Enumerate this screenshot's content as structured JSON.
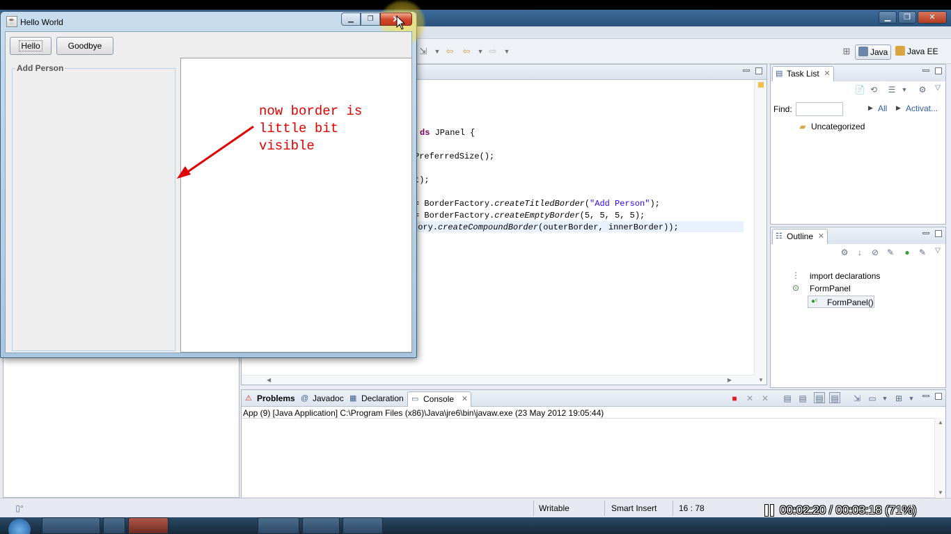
{
  "swing_window": {
    "title": "Hello World",
    "buttons": {
      "hello": "Hello",
      "goodbye": "Goodbye"
    },
    "form_panel_title": "Add Person"
  },
  "annotation": {
    "text": "now border is\nlittle bit\nvisible",
    "color": "#e00000"
  },
  "eclipse": {
    "perspectives": [
      {
        "label": "Java",
        "active": true
      },
      {
        "label": "Java EE",
        "active": false
      }
    ],
    "editor": {
      "code_lines": {
        "class_decl_kw": "ds",
        "class_decl_rest": " JPanel {",
        "size_line": "PreferredSize();",
        "set_size_line": "t);",
        "outer_prefix": "= BorderFactory.",
        "outer_method": "createTitledBorder",
        "outer_arg": "\"Add Person\"",
        "outer_end": ");",
        "inner_prefix": "= BorderFactory.",
        "inner_method": "createEmptyBorder",
        "inner_args": "(5, 5, 5, 5);",
        "compound_prefix": "tory.",
        "compound_method": "createCompoundBorder",
        "compound_args": "(outerBorder, innerBorder));"
      }
    },
    "task_list": {
      "tab_label": "Task List",
      "find_label": "Find:",
      "find_value": "",
      "all_label": "All",
      "activate_label": "Activat...",
      "category": "Uncategorized"
    },
    "outline": {
      "tab_label": "Outline",
      "items": [
        {
          "label": "import declarations"
        },
        {
          "label": "FormPanel"
        },
        {
          "label": "FormPanel()"
        }
      ]
    },
    "console": {
      "tabs": [
        "Problems",
        "Javadoc",
        "Declaration",
        "Console"
      ],
      "active_tab": "Console",
      "status": "App (9) [Java Application] C:\\Program Files (x86)\\Java\\jre6\\bin\\javaw.exe (23 May 2012 19:05:44)"
    },
    "statusbar": {
      "writable": "Writable",
      "insert_mode": "Smart Insert",
      "position": "16 : 78"
    }
  },
  "video_overlay": {
    "time_text": "00:02:20 / 00:03:18 (71%)",
    "progress_percent": 71
  },
  "icons": {
    "annotation_arrow": "arrow-icon",
    "cursor": "mouse-cursor-icon"
  }
}
